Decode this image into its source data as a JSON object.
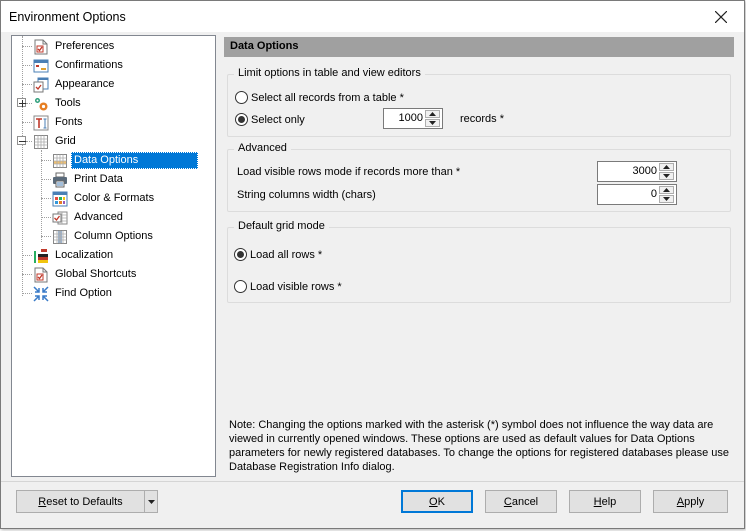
{
  "window": {
    "title": "Environment Options",
    "close_icon": "close-icon"
  },
  "tree": {
    "items": [
      {
        "label": "Preferences",
        "icon": "preferences-icon",
        "level": 0
      },
      {
        "label": "Confirmations",
        "icon": "confirmations-icon",
        "level": 0
      },
      {
        "label": "Appearance",
        "icon": "appearance-icon",
        "level": 0
      },
      {
        "label": "Tools",
        "icon": "tools-gears-icon",
        "level": 0,
        "expander": "collapsed"
      },
      {
        "label": "Fonts",
        "icon": "fonts-icon",
        "level": 0
      },
      {
        "label": "Grid",
        "icon": "grid-icon",
        "level": 0,
        "expander": "expanded"
      },
      {
        "label": "Data Options",
        "icon": "data-options-icon",
        "level": 1,
        "selected": true
      },
      {
        "label": "Print Data",
        "icon": "printer-icon",
        "level": 1
      },
      {
        "label": "Color & Formats",
        "icon": "color-formats-icon",
        "level": 1
      },
      {
        "label": "Advanced",
        "icon": "advanced-icon",
        "level": 1
      },
      {
        "label": "Column Options",
        "icon": "column-options-icon",
        "level": 1
      },
      {
        "label": "Localization",
        "icon": "localization-icon",
        "level": 0
      },
      {
        "label": "Global Shortcuts",
        "icon": "global-shortcuts-icon",
        "level": 0
      },
      {
        "label": "Find Option",
        "icon": "find-option-icon",
        "level": 0
      }
    ]
  },
  "panel": {
    "header": "Data Options",
    "limit_group": {
      "title": "Limit options in table and view editors",
      "option_all": "Select all records from a table *",
      "option_only": "Select only",
      "selected": "only",
      "records_value": "1000",
      "records_suffix": "records *"
    },
    "advanced_group": {
      "title": "Advanced",
      "load_visible_label": "Load visible rows mode if records more than *",
      "load_visible_value": "3000",
      "string_width_label": "String columns width (chars)",
      "string_width_value": "0"
    },
    "grid_mode_group": {
      "title": "Default grid mode",
      "option_all_rows": "Load all rows *",
      "option_visible_rows": "Load visible rows *",
      "selected": "all_rows"
    },
    "note": "Note: Changing the options marked with the asterisk (*) symbol does not influence the way data are viewed in currently opened windows. These options are used as default values for Data Options parameters for newly registered databases. To change the options for registered databases please use Database Registration Info dialog."
  },
  "footer": {
    "reset_mnemonic": "R",
    "reset_rest": "eset to Defaults",
    "ok_mnemonic": "O",
    "ok_rest": "K",
    "cancel_mnemonic": "C",
    "cancel_rest": "ancel",
    "help_mnemonic": "H",
    "help_rest": "elp",
    "apply_mnemonic": "A",
    "apply_rest": "pply"
  },
  "colors": {
    "selection": "#0078d7",
    "header_bar": "#a0a0a0",
    "dialog_bg": "#f0f0f0"
  }
}
